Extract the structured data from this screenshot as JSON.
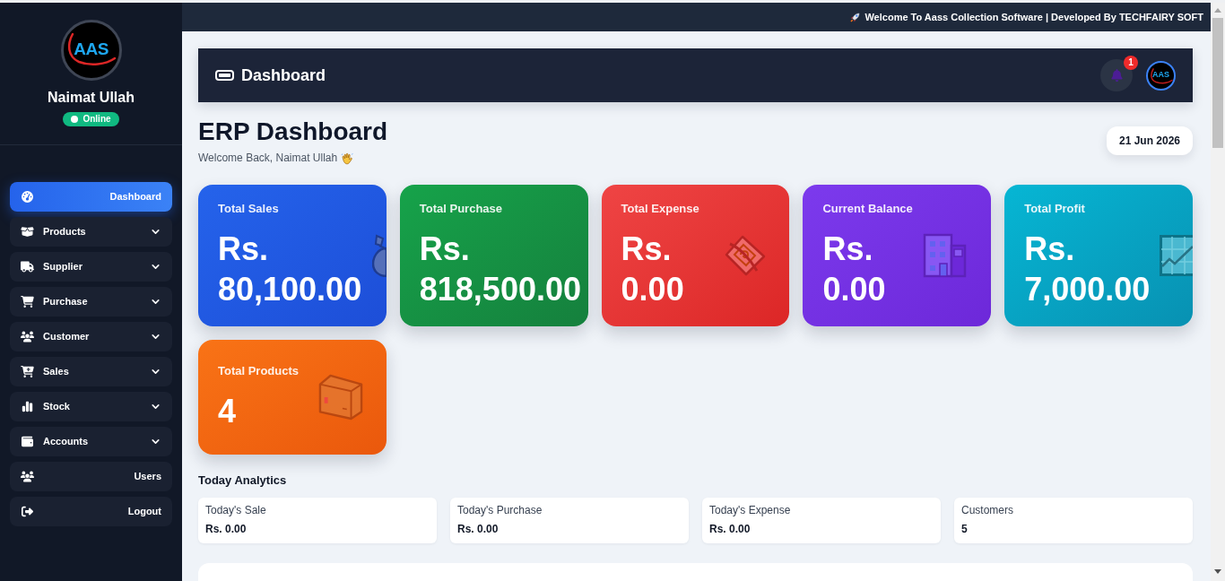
{
  "top_bar": {
    "text": "Welcome To Aass Collection Software | Developed By TECHFAIRY SOFT"
  },
  "sidebar": {
    "logo_text": "AAS",
    "user_name": "Naimat Ullah",
    "status": {
      "label": "Online",
      "online": true
    },
    "items": [
      {
        "label": "Dashboard",
        "kind": "dashboard",
        "submenu": false,
        "selected": true
      },
      {
        "label": "Products",
        "kind": "products",
        "submenu": true,
        "selected": false
      },
      {
        "label": "Supplier",
        "kind": "supplier",
        "submenu": true,
        "selected": false
      },
      {
        "label": "Purchase",
        "kind": "purchase",
        "submenu": true,
        "selected": false
      },
      {
        "label": "Customer",
        "kind": "customer",
        "submenu": true,
        "selected": false
      },
      {
        "label": "Sales",
        "kind": "sales",
        "submenu": true,
        "selected": false
      },
      {
        "label": "Stock",
        "kind": "stock",
        "submenu": true,
        "selected": false
      },
      {
        "label": "Accounts",
        "kind": "accounts",
        "submenu": true,
        "selected": false
      },
      {
        "label": "Users",
        "kind": "users",
        "submenu": false,
        "selected": false
      },
      {
        "label": "Logout",
        "kind": "logout",
        "submenu": false,
        "selected": false
      }
    ]
  },
  "header": {
    "title": "Dashboard",
    "notification_count": "1",
    "avatar_text": "AAS"
  },
  "page": {
    "title": "ERP Dashboard",
    "subtitle": "Welcome Back, Naimat Ullah",
    "date": "21 Jun 2026"
  },
  "stat_cards": [
    {
      "kind": "sales",
      "title": "Total Sales",
      "value": "Rs. 80,100.00"
    },
    {
      "kind": "purchase",
      "title": "Total Purchase",
      "value": "Rs. 818,500.00"
    },
    {
      "kind": "expense",
      "title": "Total Expense",
      "value": "Rs. 0.00"
    },
    {
      "kind": "balance",
      "title": "Current Balance",
      "value": "Rs. 0.00"
    },
    {
      "kind": "profit",
      "title": "Total Profit",
      "value": "Rs. 7,000.00"
    },
    {
      "kind": "products",
      "title": "Total Products",
      "value": "4"
    }
  ],
  "today_analytics": {
    "title": "Today Analytics",
    "items": [
      {
        "label": "Today's Sale",
        "value": "Rs. 0.00"
      },
      {
        "label": "Today's Purchase",
        "value": "Rs. 0.00"
      },
      {
        "label": "Today's Expense",
        "value": "Rs. 0.00"
      },
      {
        "label": "Customers",
        "value": "5"
      }
    ]
  }
}
